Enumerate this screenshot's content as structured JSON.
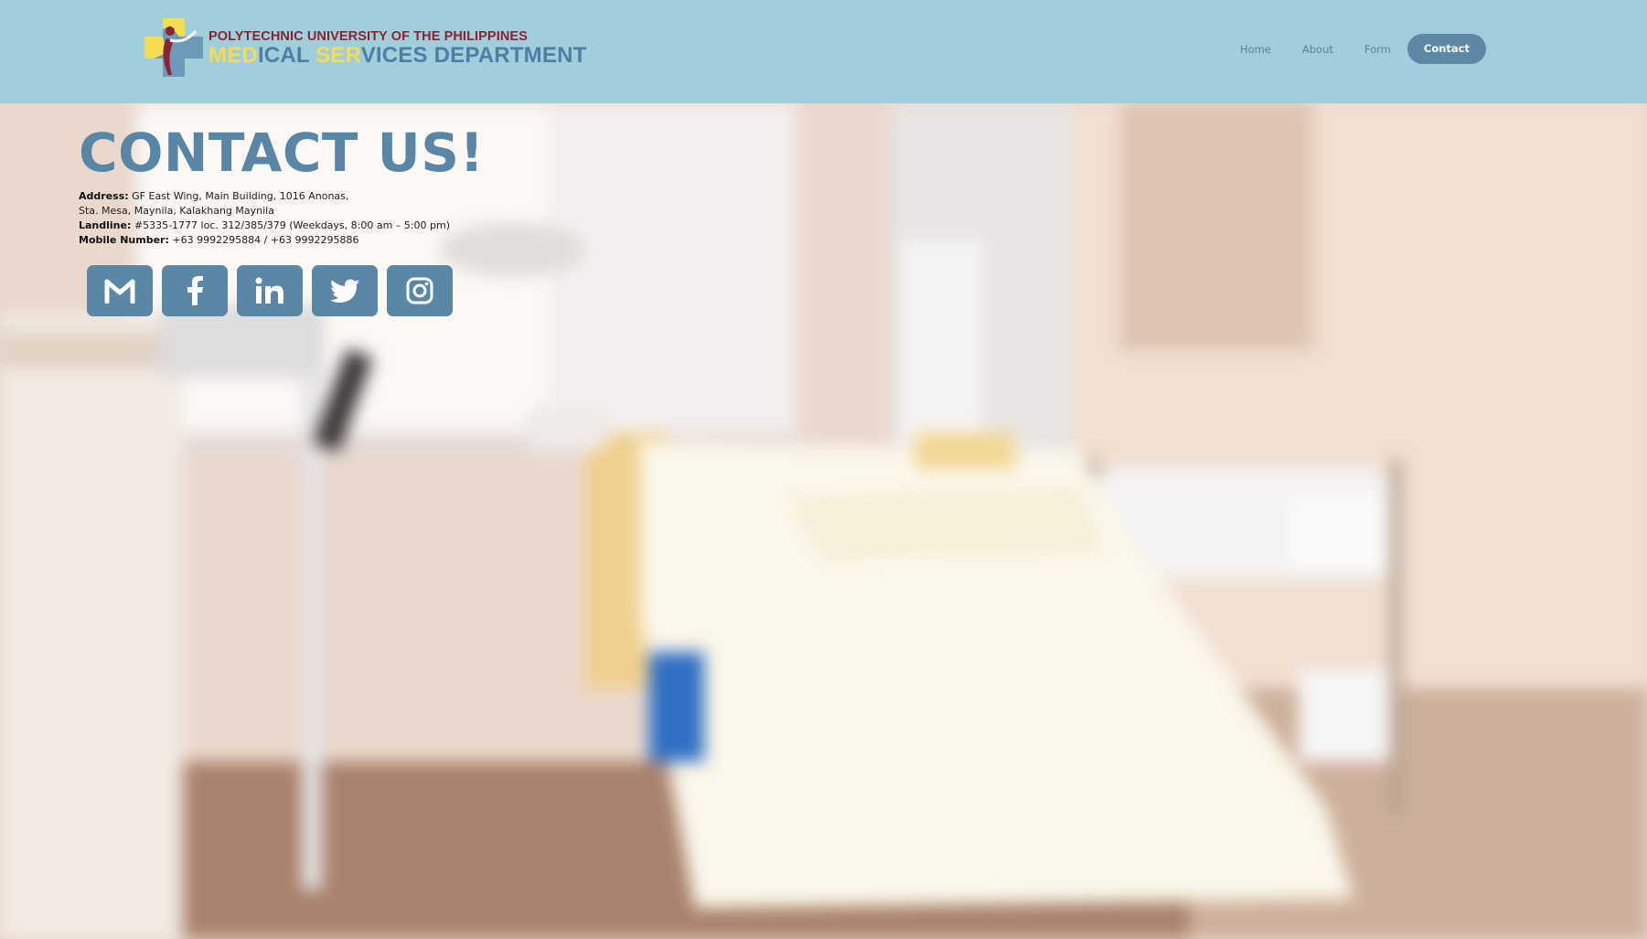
{
  "header": {
    "logo_line1": "POLYTECHNIC UNIVERSITY OF THE PHILIPPINES",
    "logo_main_parts": [
      "MED",
      "ICAL ",
      "SER",
      "VICES DEPARTMENT"
    ],
    "nav": [
      {
        "label": "Home"
      },
      {
        "label": "About"
      },
      {
        "label": "Form"
      },
      {
        "label": "Contact",
        "active": true
      }
    ]
  },
  "contact": {
    "title": "CONTACT US!",
    "address_label": "Address:",
    "address_line1": "GF East Wing, Main Building, 1016 Anonas,",
    "address_line2": "Sta. Mesa, Maynila, Kalakhang Maynila",
    "landline_label": "Landline:",
    "landline_value": "#5335-1777 loc. 312/385/379 (Weekdays, 8:00 am – 5:00 pm)",
    "mobile_label": "Mobile Number:",
    "mobile_value": "+63 9992295884 / +63 9992295886"
  },
  "socials": [
    "gmail-icon",
    "facebook-icon",
    "linkedin-icon",
    "twitter-icon",
    "instagram-icon"
  ],
  "colors": {
    "header_bg": "#a0cedb",
    "accent": "#5a87a6",
    "logo_yellow": "#f4dc55",
    "logo_red": "#8c2234"
  }
}
